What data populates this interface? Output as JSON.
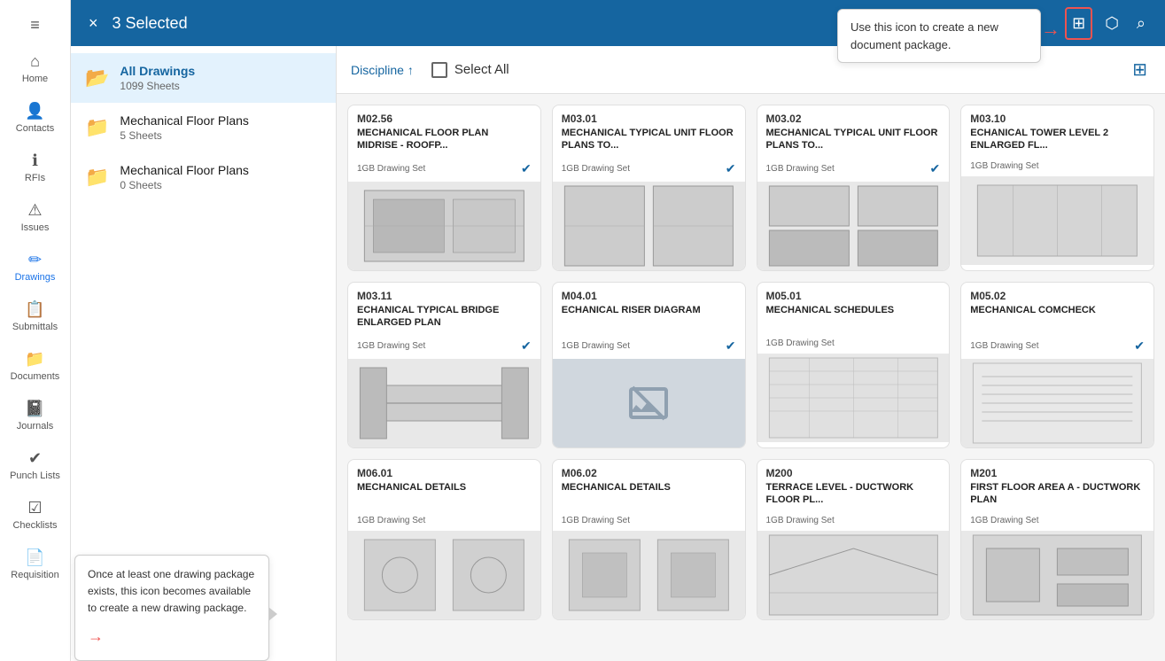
{
  "header": {
    "selected_count": "3 Selected",
    "close_label": "×",
    "tooltip_top": "Use this icon to create a\nnew document package.",
    "tooltip_bottom": "Once at least one drawing package exists, this icon becomes available to create a new drawing package."
  },
  "nav": {
    "items": [
      {
        "id": "home",
        "label": "Home",
        "icon": "⌂"
      },
      {
        "id": "contacts",
        "label": "Contacts",
        "icon": "👤"
      },
      {
        "id": "rfis",
        "label": "RFIs",
        "icon": "ℹ"
      },
      {
        "id": "issues",
        "label": "Issues",
        "icon": "⚠"
      },
      {
        "id": "drawings",
        "label": "Drawings",
        "icon": "✏"
      },
      {
        "id": "submittals",
        "label": "Submittals",
        "icon": "📋"
      },
      {
        "id": "documents",
        "label": "Documents",
        "icon": "📁"
      },
      {
        "id": "journals",
        "label": "Journals",
        "icon": "📓"
      },
      {
        "id": "punch-lists",
        "label": "Punch Lists",
        "icon": "✔"
      },
      {
        "id": "checklists",
        "label": "Checklists",
        "icon": "☑"
      },
      {
        "id": "requisition",
        "label": "Requisition",
        "icon": "📄"
      }
    ]
  },
  "folders": [
    {
      "id": "all-drawings",
      "name": "All Drawings",
      "sheets": "1099 Sheets",
      "active": true
    },
    {
      "id": "mech-floor-1",
      "name": "Mechanical Floor Plans",
      "sheets": "5 Sheets",
      "active": false
    },
    {
      "id": "mech-floor-2",
      "name": "Mechanical Floor Plans",
      "sheets": "0 Sheets",
      "active": false
    }
  ],
  "toolbar": {
    "discipline_label": "Discipline",
    "select_all_label": "Select All"
  },
  "drawings": [
    {
      "code": "M02.56",
      "title": "MECHANICAL FLOOR PLAN MIDRISE - ROOFP...",
      "set": "1GB Drawing Set",
      "verified": true,
      "has_thumbnail": true
    },
    {
      "code": "M03.01",
      "title": "MECHANICAL TYPICAL UNIT FLOOR PLANS TO...",
      "set": "1GB Drawing Set",
      "verified": true,
      "has_thumbnail": true
    },
    {
      "code": "M03.02",
      "title": "MECHANICAL TYPICAL UNIT FLOOR PLANS TO...",
      "set": "1GB Drawing Set",
      "verified": true,
      "has_thumbnail": true
    },
    {
      "code": "M03.10",
      "title": "ECHANICAL TOWER LEVEL 2 ENLARGED FL...",
      "set": "1GB Drawing Set",
      "verified": false,
      "has_thumbnail": true
    },
    {
      "code": "M03.11",
      "title": "ECHANICAL TYPICAL BRIDGE ENLARGED PLAN",
      "set": "1GB Drawing Set",
      "verified": true,
      "has_thumbnail": true
    },
    {
      "code": "M04.01",
      "title": "ECHANICAL RISER DIAGRAM",
      "set": "1GB Drawing Set",
      "verified": true,
      "has_thumbnail": false
    },
    {
      "code": "M05.01",
      "title": "MECHANICAL SCHEDULES",
      "set": "1GB Drawing Set",
      "verified": false,
      "has_thumbnail": true
    },
    {
      "code": "M05.02",
      "title": "MECHANICAL COMCHECK",
      "set": "1GB Drawing Set",
      "verified": true,
      "has_thumbnail": true
    },
    {
      "code": "M06.01",
      "title": "MECHANICAL DETAILS",
      "set": "1GB Drawing Set",
      "verified": false,
      "has_thumbnail": true
    },
    {
      "code": "M06.02",
      "title": "MECHANICAL DETAILS",
      "set": "1GB Drawing Set",
      "verified": false,
      "has_thumbnail": true
    },
    {
      "code": "M200",
      "title": "TERRACE LEVEL - DUCTWORK FLOOR PL...",
      "set": "1GB Drawing Set",
      "verified": false,
      "has_thumbnail": true
    },
    {
      "code": "M201",
      "title": "FIRST FLOOR AREA A - DUCTWORK PLAN",
      "set": "1GB Drawing Set",
      "verified": false,
      "has_thumbnail": true
    }
  ],
  "new_package_btn_label": "+",
  "icons": {
    "hamburger": "≡",
    "close": "✕",
    "folder_package": "⊞",
    "share": "⬡",
    "search": "⌕",
    "sort_asc": "↑",
    "grid": "⊞",
    "folder": "📁",
    "verified": "✔",
    "no_image": "🚫"
  }
}
